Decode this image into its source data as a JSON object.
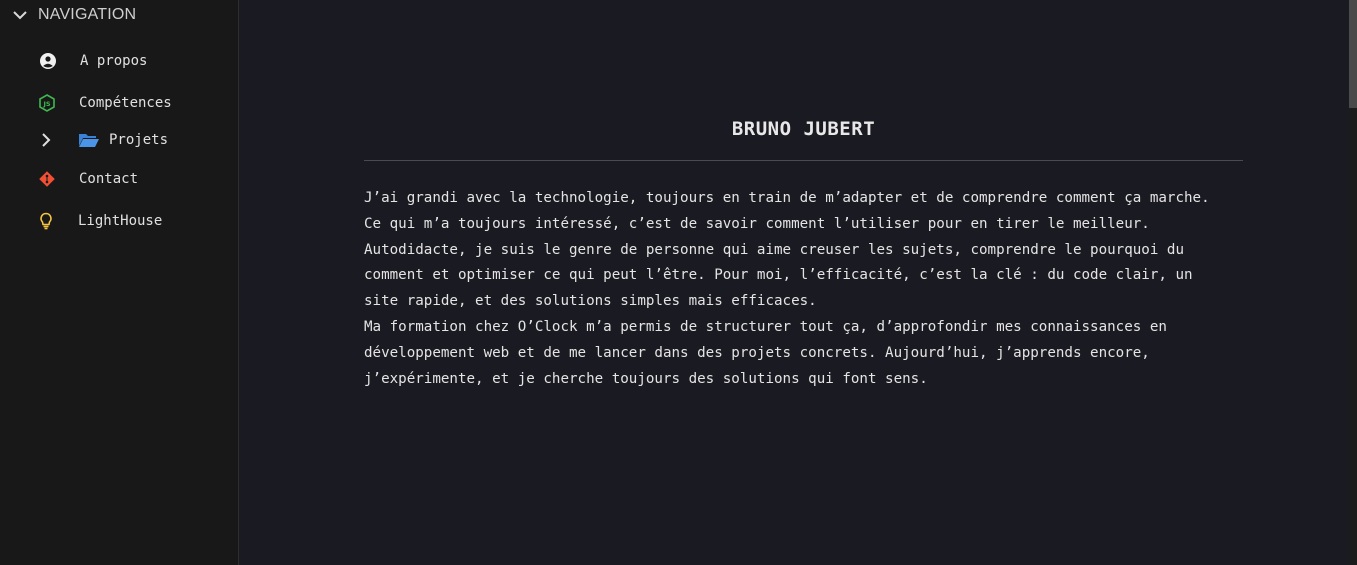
{
  "sidebar": {
    "header": {
      "title": "NAVIGATION",
      "icon": "chevron-down-icon"
    },
    "items": [
      {
        "label": "A propos",
        "icon": "user-circle-icon"
      },
      {
        "label": "Compétences",
        "icon": "nodejs-icon"
      },
      {
        "label": "Projets",
        "icon": "folder-open-icon",
        "expand_icon": "chevron-right-icon"
      },
      {
        "label": "Contact",
        "icon": "git-icon"
      },
      {
        "label": "LightHouse",
        "icon": "lightbulb-icon"
      }
    ]
  },
  "main": {
    "title": "BRUNO JUBERT",
    "bio": [
      "J’ai grandi avec la technologie, toujours en train de m’adapter et de comprendre comment ça marche.",
      "Ce qui m’a toujours intéressé, c’est de savoir comment l’utiliser pour en tirer le meilleur.",
      "Autodidacte, je suis le genre de personne qui aime creuser les sujets, comprendre le pourquoi du",
      "comment et optimiser ce qui peut l’être. Pour moi, l’efficacité, c’est la clé : du code clair, un",
      "site rapide, et des solutions simples mais efficaces.",
      "Ma formation chez O’Clock m’a permis de structurer tout ça, d’approfondir mes connaissances en",
      "développement web et de me lancer dans des projets concrets. Aujourd’hui, j’apprends encore,",
      "j’expérimente, et je cherche toujours des solutions qui font sens."
    ]
  },
  "colors": {
    "sidebar_bg": "#181818",
    "main_bg": "#1a1a22",
    "node_green": "#3fb950",
    "git_red": "#f05033",
    "folder_blue": "#3b82d6",
    "bulb_yellow": "#f5c542"
  }
}
